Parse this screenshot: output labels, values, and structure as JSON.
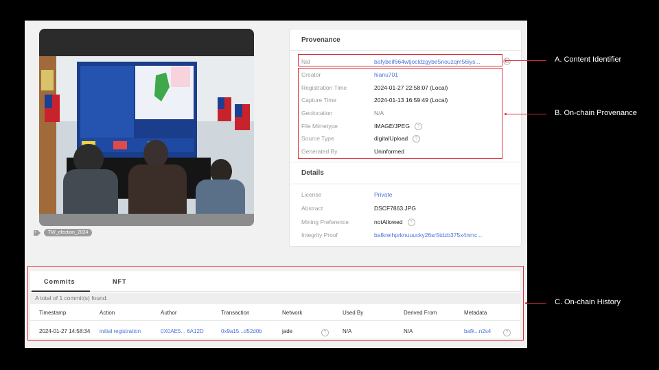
{
  "tag": "TW_election_2024",
  "provenance": {
    "title": "Provenance",
    "nid": {
      "key": "Nid",
      "value": "bafybeif664wtjocldzgybe5nouzqm56iys..."
    },
    "rows": [
      {
        "key": "Creator",
        "value": "hianu701"
      },
      {
        "key": "Registration Time",
        "value": "2024-01-27 22:58:07 (Local)"
      },
      {
        "key": "Capture Time",
        "value": "2024-01-13 16:59:49 (Local)"
      },
      {
        "key": "Geolocation",
        "value": "N/A"
      },
      {
        "key": "File Mimetype",
        "value": "IMAGE/JPEG"
      },
      {
        "key": "Source Type",
        "value": "digitalUpload"
      },
      {
        "key": "Generated By",
        "value": "Uninformed"
      }
    ]
  },
  "details": {
    "title": "Details",
    "rows": [
      {
        "key": "License",
        "value": "Private"
      },
      {
        "key": "Abstract",
        "value": "DSCF7863.JPG"
      },
      {
        "key": "Mining Preference",
        "value": "notAllowed"
      },
      {
        "key": "Integrity Proof",
        "value": "bafkreihprknuuucky26sr5tdzb375x4nmc..."
      }
    ]
  },
  "history": {
    "tabs": [
      "Commits",
      "NFT"
    ],
    "count_text": "A total of 1 commit(s) found.",
    "columns": [
      "Timestamp",
      "Action",
      "Author",
      "Transaction",
      "Network",
      "Used By",
      "Derived From",
      "Metadata"
    ],
    "row": {
      "timestamp": "2024-01-27 14:58:34",
      "action": "initial registration",
      "author": "0X0AE5... 6A12D",
      "transaction": "0x9a15...d52d0b",
      "network": "jade",
      "used_by": "N/A",
      "derived_from": "N/A",
      "metadata": "bafk...n2s4"
    }
  },
  "annotations": {
    "a": "A. Content Identifier",
    "b": "B. On-chain Provenance",
    "c": "C. On-chain History"
  },
  "colors": {
    "annotation": "#d9303a",
    "link": "#4a74d9"
  }
}
